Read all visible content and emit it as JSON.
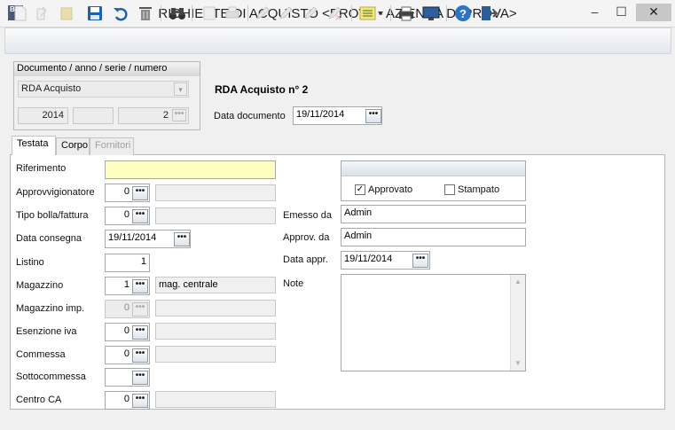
{
  "window": {
    "title": "RICHIESTE DI ACQUISTO <PROVA - AZIENDA DI PROVA>",
    "app_badge": "B",
    "app_badge_sub": "15",
    "minimize": "–",
    "maximize": "☐",
    "close": "✕"
  },
  "document_group": {
    "header": "Documento / anno / serie / numero",
    "type_value": "RDA Acquisto",
    "year": "2014",
    "series": "",
    "number": "2",
    "doc_title": "RDA Acquisto n° 2",
    "date_label": "Data documento",
    "date_value": "19/11/2014"
  },
  "tabs": [
    "Testata",
    "Corpo",
    "Fornitori"
  ],
  "form": {
    "riferimento": {
      "label": "Riferimento",
      "value": ""
    },
    "approvvigionatore": {
      "label": "Approvvigionatore",
      "value": "0",
      "desc": ""
    },
    "tipo_bolla": {
      "label": "Tipo bolla/fattura",
      "value": "0",
      "desc": ""
    },
    "data_consegna": {
      "label": "Data consegna",
      "value": "19/11/2014"
    },
    "listino": {
      "label": "Listino",
      "value": "1"
    },
    "magazzino": {
      "label": "Magazzino",
      "value": "1",
      "desc": "mag. centrale"
    },
    "magazzino_imp": {
      "label": "Magazzino imp.",
      "value": "0",
      "desc": ""
    },
    "esenzione_iva": {
      "label": "Esenzione iva",
      "value": "0",
      "desc": ""
    },
    "commessa": {
      "label": "Commessa",
      "value": "0",
      "desc": ""
    },
    "sottocommessa": {
      "label": "Sottocommessa",
      "value": ""
    },
    "centro_ca": {
      "label": "Centro CA",
      "value": "0",
      "desc": ""
    }
  },
  "status": {
    "approvato_label": "Approvato",
    "approvato_checked": true,
    "stampato_label": "Stampato",
    "stampato_checked": false,
    "check_mark": "✓",
    "emesso_label": "Emesso da",
    "emesso_value": "Admin",
    "approv_label": "Approv. da",
    "approv_value": "Admin",
    "data_appr_label": "Data appr.",
    "data_appr_value": "19/11/2014",
    "note_label": "Note",
    "note_value": ""
  },
  "ui": {
    "dots": "•••",
    "combo_arrow": "▾",
    "scroll_up": "▲",
    "scroll_down": "▼"
  },
  "colors": {
    "required_field": "#fdfdc0",
    "save_icon": "#1f5fb4",
    "help_icon": "#2a74c9"
  }
}
